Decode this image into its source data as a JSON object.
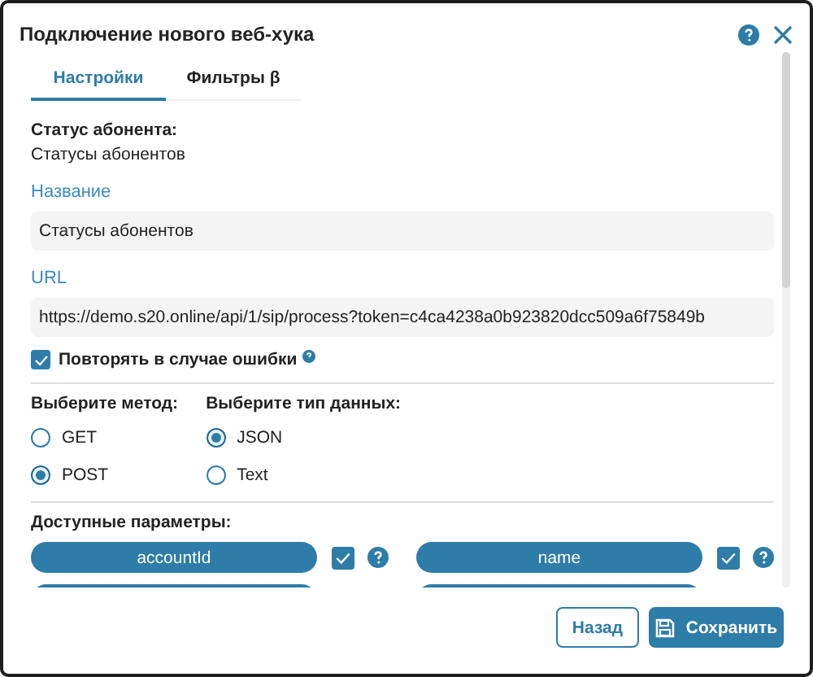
{
  "window": {
    "title": "Подключение нового веб-хука"
  },
  "tabs": [
    {
      "label": "Настройки",
      "selected": true
    },
    {
      "label": "Фильтры β",
      "selected": false
    }
  ],
  "subscriber_status": {
    "label": "Статус абонента:",
    "value": "Статусы абонентов"
  },
  "name_field": {
    "label": "Название",
    "value": "Статусы абонентов"
  },
  "url_field": {
    "label": "URL",
    "value": "https://demo.s20.online/api/1/sip/process?token=c4ca4238a0b923820dcc509a6f75849b"
  },
  "retry": {
    "label": "Повторять в случае ошибки",
    "checked": true
  },
  "method": {
    "label": "Выберите метод:",
    "options": [
      {
        "label": "GET",
        "selected": false
      },
      {
        "label": "POST",
        "selected": true
      }
    ]
  },
  "data_type": {
    "label": "Выберите тип данных:",
    "options": [
      {
        "label": "JSON",
        "selected": true
      },
      {
        "label": "Text",
        "selected": false
      }
    ]
  },
  "params": {
    "label": "Доступные параметры:",
    "items": [
      {
        "kind": "full",
        "label": "accountId",
        "checked": true
      },
      {
        "kind": "full",
        "label": "name",
        "checked": true
      },
      {
        "kind": "cut"
      },
      {
        "kind": "cut"
      }
    ]
  },
  "buttons": [
    {
      "label": "Назад",
      "kind": "secondary"
    },
    {
      "label": "Сохранить",
      "kind": "save"
    }
  ]
}
